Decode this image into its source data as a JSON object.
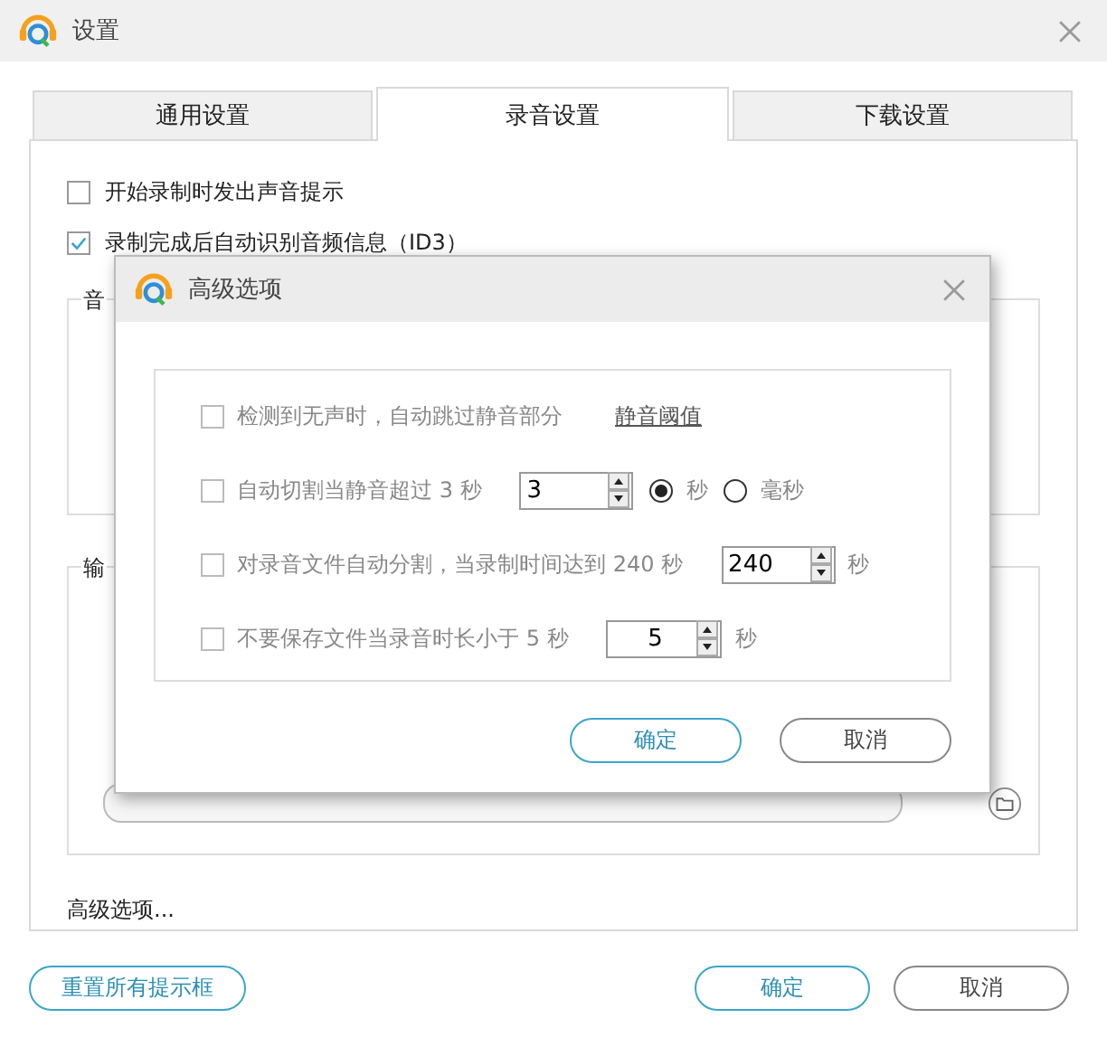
{
  "window": {
    "title": "设置"
  },
  "tabs": [
    {
      "label": "通用设置",
      "selected": false
    },
    {
      "label": "录音设置",
      "selected": true
    },
    {
      "label": "下载设置",
      "selected": false
    }
  ],
  "options": [
    {
      "label": "开始录制时发出声音提示",
      "checked": false
    },
    {
      "label": "录制完成后自动识别音频信息（ID3）",
      "checked": true
    }
  ],
  "audio_group": {
    "label": "音"
  },
  "output_group": {
    "label": "输"
  },
  "advanced_link": "高级选项...",
  "footer": {
    "reset": "重置所有提示框",
    "buttons": [
      {
        "label": "确定",
        "primary": true
      },
      {
        "label": "取消",
        "primary": false
      }
    ]
  },
  "dialog": {
    "title": "高级选项",
    "options": [
      {
        "kind": "link",
        "label": "检测到无声时，自动跳过静音部分",
        "checked": false,
        "disabled": true,
        "link": "静音阈值"
      },
      {
        "kind": "spin_radio",
        "label": "自动切割当静音超过 3 秒",
        "checked": false,
        "disabled": true,
        "value": "3",
        "units": [
          {
            "label": "秒",
            "selected": true
          },
          {
            "label": "毫秒",
            "selected": false
          }
        ]
      },
      {
        "kind": "spin",
        "label": "对录音文件自动分割，当录制时间达到 240 秒",
        "checked": false,
        "disabled": true,
        "value": "240",
        "unit": "秒"
      },
      {
        "kind": "spin",
        "label": "不要保存文件当录音时长小于 5 秒",
        "checked": false,
        "disabled": true,
        "value": "5",
        "unit": "秒"
      }
    ],
    "buttons": [
      {
        "label": "确定",
        "primary": true
      },
      {
        "label": "取消",
        "primary": false
      }
    ]
  }
}
